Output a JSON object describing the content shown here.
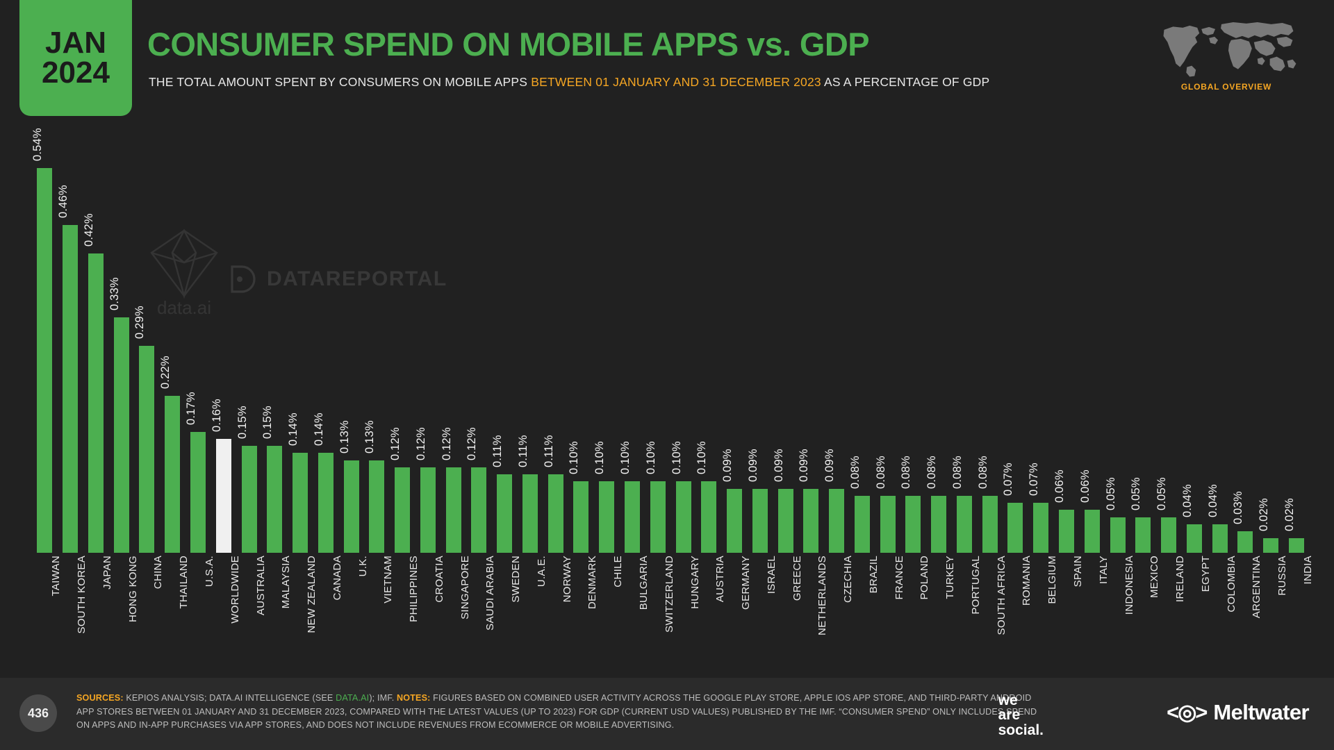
{
  "header": {
    "date_month": "JAN",
    "date_year": "2024",
    "title": "CONSUMER SPEND ON MOBILE APPS vs. GDP",
    "subtitle_part1": "THE TOTAL AMOUNT SPENT BY CONSUMERS ON MOBILE APPS ",
    "subtitle_highlight": "BETWEEN 01 JANUARY AND 31 DECEMBER 2023",
    "subtitle_part2": " AS A PERCENTAGE OF GDP",
    "globe_label": "GLOBAL OVERVIEW"
  },
  "watermarks": {
    "data_ai": "data.ai",
    "datareportal": "DATAREPORTAL"
  },
  "footer": {
    "page_number": "436",
    "sources_label": "SOURCES:",
    "sources_text_a": " KEPIOS ANALYSIS; DATA.AI INTELLIGENCE (SEE ",
    "sources_link": "DATA.AI",
    "sources_text_b": "); IMF. ",
    "notes_label": "NOTES:",
    "notes_text": " FIGURES BASED ON COMBINED USER ACTIVITY ACROSS THE GOOGLE PLAY STORE, APPLE IOS APP STORE, AND THIRD-PARTY ANDROID APP STORES BETWEEN 01 JANUARY AND 31 DECEMBER 2023, COMPARED WITH THE LATEST VALUES (UP TO 2023) FOR GDP (CURRENT USD VALUES) PUBLISHED BY THE IMF. “CONSUMER SPEND” ONLY INCLUDES SPEND ON APPS AND IN-APP PURCHASES VIA APP STORES, AND DOES NOT INCLUDE REVENUES FROM ECOMMERCE OR MOBILE ADVERTISING.",
    "brand_we": "we",
    "brand_are": "are",
    "brand_social": "social.",
    "brand_meltwater": "Meltwater"
  },
  "colors": {
    "background": "#212121",
    "accent_green": "#4caf50",
    "accent_orange": "#f5a623",
    "highlight_bar": "#f0f0f0",
    "footer_bg": "#2b2b2b",
    "text": "#e9e9e9"
  },
  "chart_data": {
    "type": "bar",
    "title": "CONSUMER SPEND ON MOBILE APPS vs. GDP",
    "subtitle": "THE TOTAL AMOUNT SPENT BY CONSUMERS ON MOBILE APPS BETWEEN 01 JANUARY AND 31 DECEMBER 2023 AS A PERCENTAGE OF GDP",
    "xlabel": "",
    "ylabel": "",
    "ylim": [
      0,
      0.54
    ],
    "grid": false,
    "legend": "none",
    "unit": "%",
    "highlight_category": "WORLDWIDE",
    "categories": [
      "TAIWAN",
      "SOUTH KOREA",
      "JAPAN",
      "HONG KONG",
      "CHINA",
      "THAILAND",
      "U.S.A.",
      "WORLDWIDE",
      "AUSTRALIA",
      "MALAYSIA",
      "NEW ZEALAND",
      "CANADA",
      "U.K.",
      "VIETNAM",
      "PHILIPPINES",
      "CROATIA",
      "SINGAPORE",
      "SAUDI ARABIA",
      "SWEDEN",
      "U.A.E.",
      "NORWAY",
      "DENMARK",
      "CHILE",
      "BULGARIA",
      "SWITZERLAND",
      "HUNGARY",
      "AUSTRIA",
      "GERMANY",
      "ISRAEL",
      "GREECE",
      "NETHERLANDS",
      "CZECHIA",
      "BRAZIL",
      "FRANCE",
      "POLAND",
      "TURKEY",
      "PORTUGAL",
      "SOUTH AFRICA",
      "ROMANIA",
      "BELGIUM",
      "SPAIN",
      "ITALY",
      "INDONESIA",
      "MEXICO",
      "IRELAND",
      "EGYPT",
      "COLOMBIA",
      "ARGENTINA",
      "RUSSIA",
      "INDIA"
    ],
    "values": [
      0.54,
      0.46,
      0.42,
      0.33,
      0.29,
      0.22,
      0.17,
      0.16,
      0.15,
      0.15,
      0.14,
      0.14,
      0.13,
      0.13,
      0.12,
      0.12,
      0.12,
      0.12,
      0.11,
      0.11,
      0.11,
      0.1,
      0.1,
      0.1,
      0.1,
      0.1,
      0.1,
      0.09,
      0.09,
      0.09,
      0.09,
      0.09,
      0.08,
      0.08,
      0.08,
      0.08,
      0.08,
      0.08,
      0.07,
      0.07,
      0.06,
      0.06,
      0.05,
      0.05,
      0.05,
      0.04,
      0.04,
      0.03,
      0.02,
      0.02
    ],
    "labels": [
      "0.54%",
      "0.46%",
      "0.42%",
      "0.33%",
      "0.29%",
      "0.22%",
      "0.17%",
      "0.16%",
      "0.15%",
      "0.15%",
      "0.14%",
      "0.14%",
      "0.13%",
      "0.13%",
      "0.12%",
      "0.12%",
      "0.12%",
      "0.12%",
      "0.11%",
      "0.11%",
      "0.11%",
      "0.10%",
      "0.10%",
      "0.10%",
      "0.10%",
      "0.10%",
      "0.10%",
      "0.09%",
      "0.09%",
      "0.09%",
      "0.09%",
      "0.09%",
      "0.08%",
      "0.08%",
      "0.08%",
      "0.08%",
      "0.08%",
      "0.08%",
      "0.07%",
      "0.07%",
      "0.06%",
      "0.06%",
      "0.05%",
      "0.05%",
      "0.05%",
      "0.04%",
      "0.04%",
      "0.03%",
      "0.02%",
      "0.02%"
    ]
  }
}
